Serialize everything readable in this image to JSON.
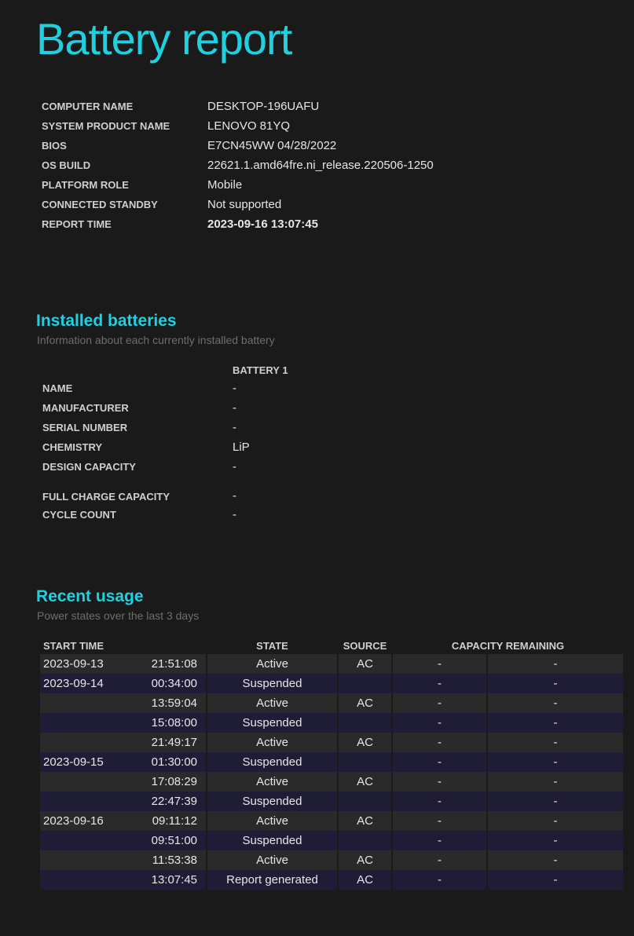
{
  "page": {
    "title": "Battery report"
  },
  "system_info": [
    {
      "label": "COMPUTER NAME",
      "value": "DESKTOP-196UAFU"
    },
    {
      "label": "SYSTEM PRODUCT NAME",
      "value": "LENOVO 81YQ"
    },
    {
      "label": "BIOS",
      "value": "E7CN45WW 04/28/2022"
    },
    {
      "label": "OS BUILD",
      "value": "22621.1.amd64fre.ni_release.220506-1250"
    },
    {
      "label": "PLATFORM ROLE",
      "value": "Mobile"
    },
    {
      "label": "CONNECTED STANDBY",
      "value": "Not supported"
    },
    {
      "label": "REPORT TIME",
      "value": "2023-09-16  13:07:45"
    }
  ],
  "installed_batteries": {
    "heading": "Installed batteries",
    "subheading": "Information about each currently installed battery",
    "column": "BATTERY 1",
    "rows": [
      {
        "label": "NAME",
        "value": "-"
      },
      {
        "label": "MANUFACTURER",
        "value": "-"
      },
      {
        "label": "SERIAL NUMBER",
        "value": "-"
      },
      {
        "label": "CHEMISTRY",
        "value": "LiP"
      },
      {
        "label": "DESIGN CAPACITY",
        "value": "-"
      },
      {
        "label": "FULL CHARGE CAPACITY",
        "value": "-"
      },
      {
        "label": "CYCLE COUNT",
        "value": "-"
      }
    ]
  },
  "recent_usage": {
    "heading": "Recent usage",
    "subheading": "Power states over the last 3 days",
    "columns": [
      "START TIME",
      "STATE",
      "SOURCE",
      "CAPACITY REMAINING"
    ],
    "rows": [
      {
        "date": "2023-09-13",
        "time": "21:51:08",
        "state": "Active",
        "source": "AC",
        "cap1": "-",
        "cap2": "-"
      },
      {
        "date": "2023-09-14",
        "time": "00:34:00",
        "state": "Suspended",
        "source": "",
        "cap1": "-",
        "cap2": "-"
      },
      {
        "date": "",
        "time": "13:59:04",
        "state": "Active",
        "source": "AC",
        "cap1": "-",
        "cap2": "-"
      },
      {
        "date": "",
        "time": "15:08:00",
        "state": "Suspended",
        "source": "",
        "cap1": "-",
        "cap2": "-"
      },
      {
        "date": "",
        "time": "21:49:17",
        "state": "Active",
        "source": "AC",
        "cap1": "-",
        "cap2": "-"
      },
      {
        "date": "2023-09-15",
        "time": "01:30:00",
        "state": "Suspended",
        "source": "",
        "cap1": "-",
        "cap2": "-"
      },
      {
        "date": "",
        "time": "17:08:29",
        "state": "Active",
        "source": "AC",
        "cap1": "-",
        "cap2": "-"
      },
      {
        "date": "",
        "time": "22:47:39",
        "state": "Suspended",
        "source": "",
        "cap1": "-",
        "cap2": "-"
      },
      {
        "date": "2023-09-16",
        "time": "09:11:12",
        "state": "Active",
        "source": "AC",
        "cap1": "-",
        "cap2": "-"
      },
      {
        "date": "",
        "time": "09:51:00",
        "state": "Suspended",
        "source": "",
        "cap1": "-",
        "cap2": "-"
      },
      {
        "date": "",
        "time": "11:53:38",
        "state": "Active",
        "source": "AC",
        "cap1": "-",
        "cap2": "-"
      },
      {
        "date": "",
        "time": "13:07:45",
        "state": "Report generated",
        "source": "AC",
        "cap1": "-",
        "cap2": "-"
      }
    ]
  },
  "colors": {
    "accent": "#1fd0e0",
    "background": "#1a1a1a",
    "row_even": "#2a2a2a",
    "row_odd": "#1f1d36"
  }
}
